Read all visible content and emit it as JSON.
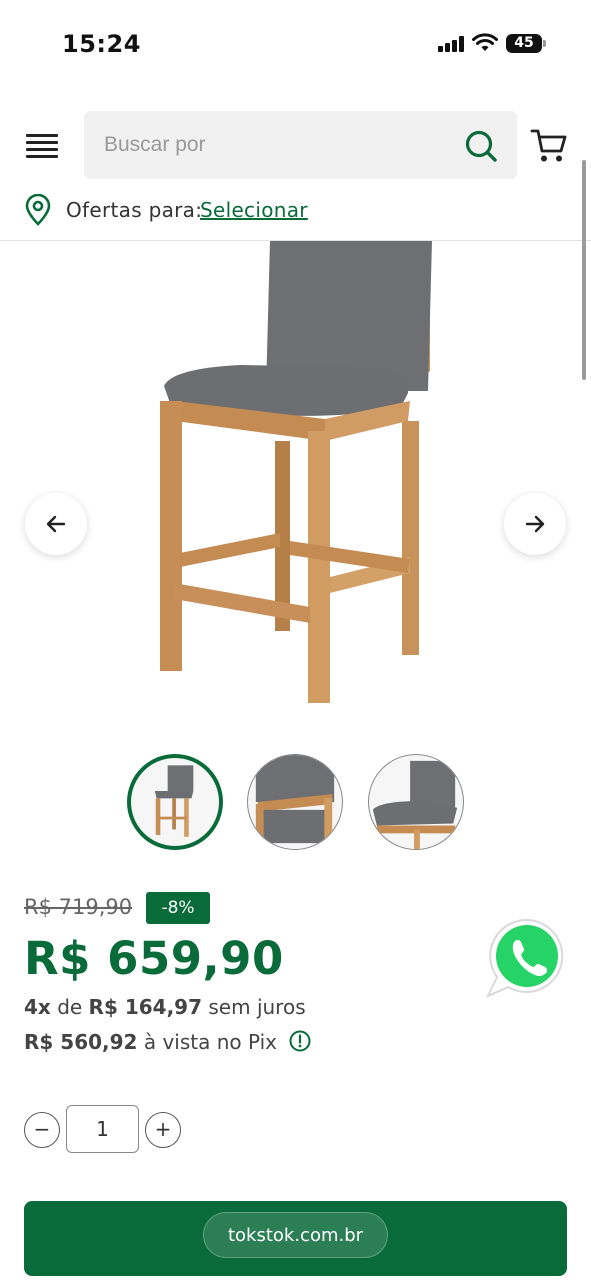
{
  "status_bar": {
    "time": "15:24",
    "battery": "45"
  },
  "header": {
    "search_placeholder": "Buscar por",
    "offers_label": "Ofertas para:",
    "offers_link": "Selecionar"
  },
  "icons": {
    "menu": "menu-icon",
    "search": "search-icon",
    "cart": "cart-icon",
    "location": "location-pin-icon",
    "prev": "arrow-left-icon",
    "next": "arrow-right-icon",
    "info": "info-icon",
    "whatsapp": "whatsapp-icon"
  },
  "product": {
    "old_price": "R$ 719,90",
    "discount": "-8%",
    "price": "R$ 659,90",
    "installments": {
      "count": "4x",
      "connector": "de",
      "amount": "R$ 164,97",
      "suffix": "sem juros"
    },
    "pix": {
      "amount": "R$ 560,92",
      "suffix": "à vista no Pix"
    }
  },
  "quantity": {
    "minus": "−",
    "value": "1",
    "plus": "+"
  },
  "browser": {
    "domain": "tokstok.com.br"
  },
  "colors": {
    "brand_green": "#0a6b3a",
    "whatsapp_green": "#25d366"
  }
}
